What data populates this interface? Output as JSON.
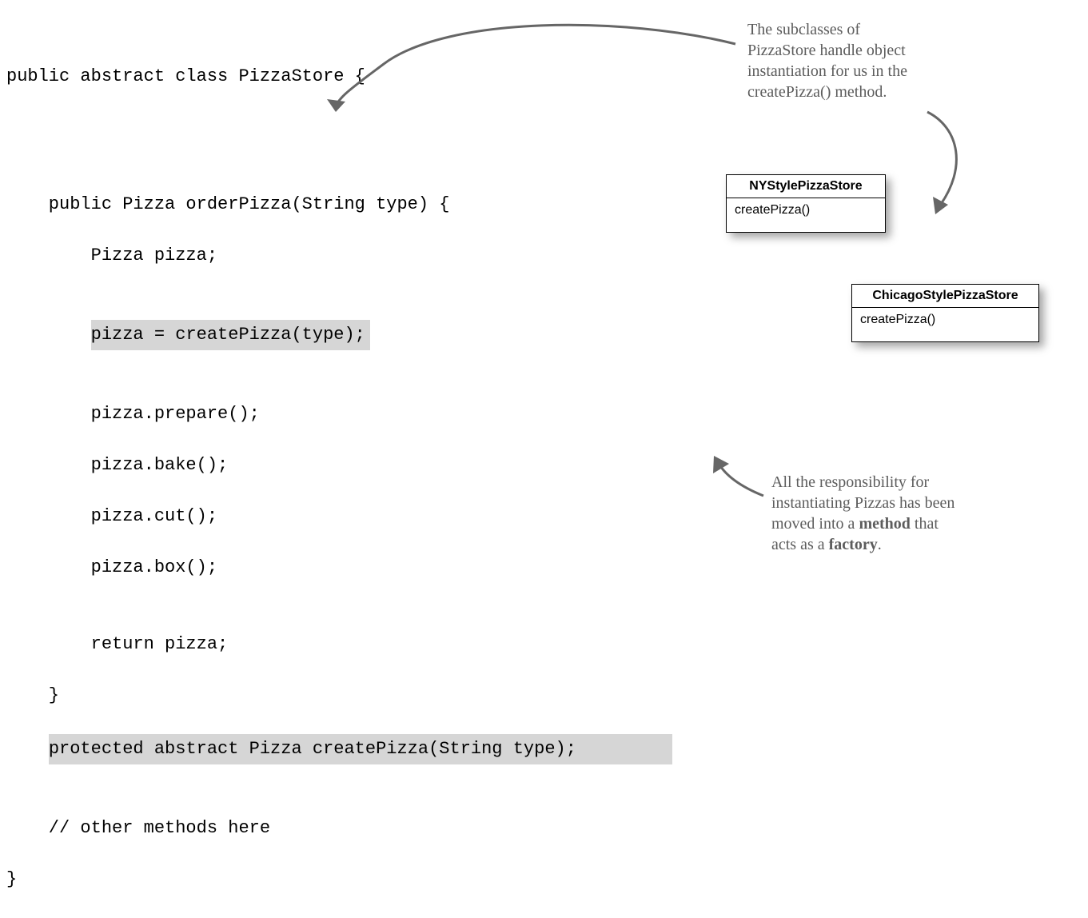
{
  "code": {
    "line1": "public abstract class PizzaStore {",
    "blank1": "",
    "blank2": "",
    "line2": "    public Pizza orderPizza(String type) {",
    "line3": "        Pizza pizza;",
    "blank3": "",
    "indent1": "        ",
    "hl1": "pizza = createPizza(type);",
    "blank4": "",
    "line4": "        pizza.prepare();",
    "line5": "        pizza.bake();",
    "line6": "        pizza.cut();",
    "line7": "        pizza.box();",
    "blank5": "",
    "line8": "        return pizza;",
    "line9": "    }",
    "indent2": "    ",
    "hl2": "protected abstract Pizza createPizza(String type);",
    "blank6": "",
    "line10": "    // other methods here",
    "line11": "}"
  },
  "uml": {
    "box1": {
      "title": "NYStylePizzaStore",
      "method": "createPizza()"
    },
    "box2": {
      "title": "ChicagoStylePizzaStore",
      "method": "createPizza()"
    }
  },
  "annotations": {
    "top": {
      "l1": "The subclasses of",
      "l2": "PizzaStore handle object",
      "l3": "instantiation for us in the",
      "l4": "createPizza() method."
    },
    "bottom": {
      "l1": "All the responsibility for",
      "l2": "instantiating Pizzas has been",
      "l3a": "moved into a ",
      "l3b": "method",
      "l3c": " that",
      "l4a": "acts as a ",
      "l4b": "factory",
      "l4c": "."
    }
  }
}
